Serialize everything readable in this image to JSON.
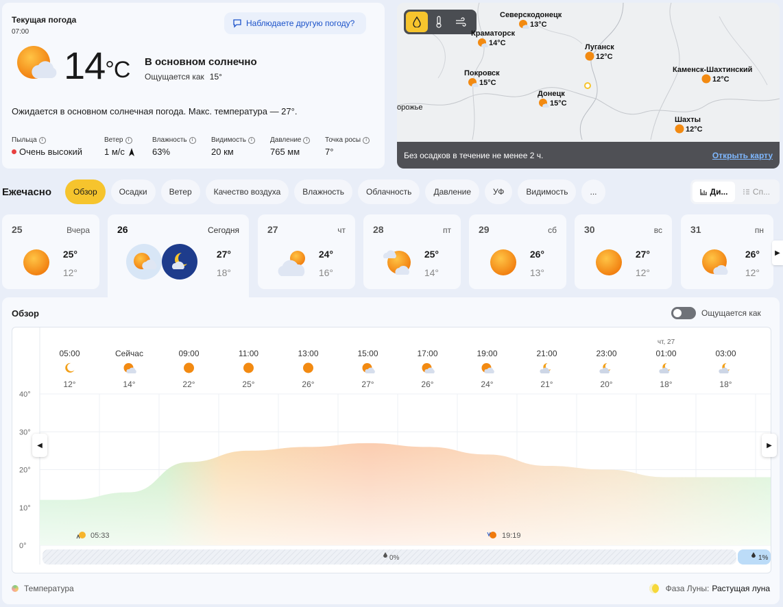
{
  "current": {
    "title": "Текущая погода",
    "time": "07:00",
    "other_weather": "Наблюдаете другую погоду?",
    "temp": "14",
    "unit": "°C",
    "condition": "В основном солнечно",
    "feels_label": "Ощущается как",
    "feels_value": "15°",
    "forecast": "Ожидается в основном солнечная погода. Макс. температура — 27°.",
    "metrics": [
      {
        "label": "Пыльца",
        "value": "Очень высокий"
      },
      {
        "label": "Ветер",
        "value": "1 м/с"
      },
      {
        "label": "Влажность",
        "value": "63%"
      },
      {
        "label": "Видимость",
        "value": "20 км"
      },
      {
        "label": "Давление",
        "value": "765 мм"
      },
      {
        "label": "Точка росы",
        "value": "7°"
      }
    ]
  },
  "map": {
    "cities": [
      {
        "name": "Северскодонецк",
        "temp": "13°C"
      },
      {
        "name": "Краматорск",
        "temp": "14°C"
      },
      {
        "name": "Луганск",
        "temp": "12°C"
      },
      {
        "name": "Покровск",
        "temp": "15°C"
      },
      {
        "name": "Донецк",
        "temp": "15°C"
      },
      {
        "name": "Каменск-Шахтинский",
        "temp": "12°C"
      },
      {
        "name": "Шахты",
        "temp": "12°C"
      }
    ],
    "partial_label": "орожье",
    "precip_text": "Без осадков в течение не менее 2 ч.",
    "open_map": "Открыть карту"
  },
  "hourly": {
    "label": "Ежечасно",
    "tabs": [
      "Обзор",
      "Осадки",
      "Ветер",
      "Качество воздуха",
      "Влажность",
      "Облачность",
      "Давление",
      "УФ",
      "Видимость",
      "..."
    ],
    "view_options": [
      "Ди...",
      "Сп..."
    ]
  },
  "days": [
    {
      "num": "25",
      "name": "Вчера",
      "max": "25°",
      "min": "12°"
    },
    {
      "num": "26",
      "name": "Сегодня",
      "max": "27°",
      "min": "18°"
    },
    {
      "num": "27",
      "name": "чт",
      "max": "24°",
      "min": "16°"
    },
    {
      "num": "28",
      "name": "пт",
      "max": "25°",
      "min": "14°"
    },
    {
      "num": "29",
      "name": "сб",
      "max": "26°",
      "min": "13°"
    },
    {
      "num": "30",
      "name": "вс",
      "max": "27°",
      "min": "12°"
    },
    {
      "num": "31",
      "name": "пн",
      "max": "26°",
      "min": "12°"
    }
  ],
  "overview": {
    "title": "Обзор",
    "feels_toggle": "Ощущается как",
    "legend": "Температура",
    "moon_label": "Фаза Луны:",
    "moon_value": "Растущая луна"
  },
  "chart_data": {
    "type": "area",
    "x": [
      "05:00",
      "Сейчас",
      "09:00",
      "11:00",
      "13:00",
      "15:00",
      "17:00",
      "19:00",
      "21:00",
      "23:00",
      "01:00",
      "03:00"
    ],
    "y_labels": [
      "12°",
      "14°",
      "22°",
      "25°",
      "26°",
      "27°",
      "26°",
      "24°",
      "21°",
      "20°",
      "18°",
      "18°"
    ],
    "values": [
      12,
      14,
      22,
      25,
      26,
      27,
      26,
      24,
      21,
      20,
      18,
      18
    ],
    "date_marker": "чт, 27",
    "yticks": [
      "40°",
      "30°",
      "20°",
      "10°",
      "0°"
    ],
    "ylim": [
      0,
      40
    ],
    "sunrise": "05:33",
    "sunset": "19:19",
    "precip": [
      "0%",
      "1%"
    ]
  }
}
